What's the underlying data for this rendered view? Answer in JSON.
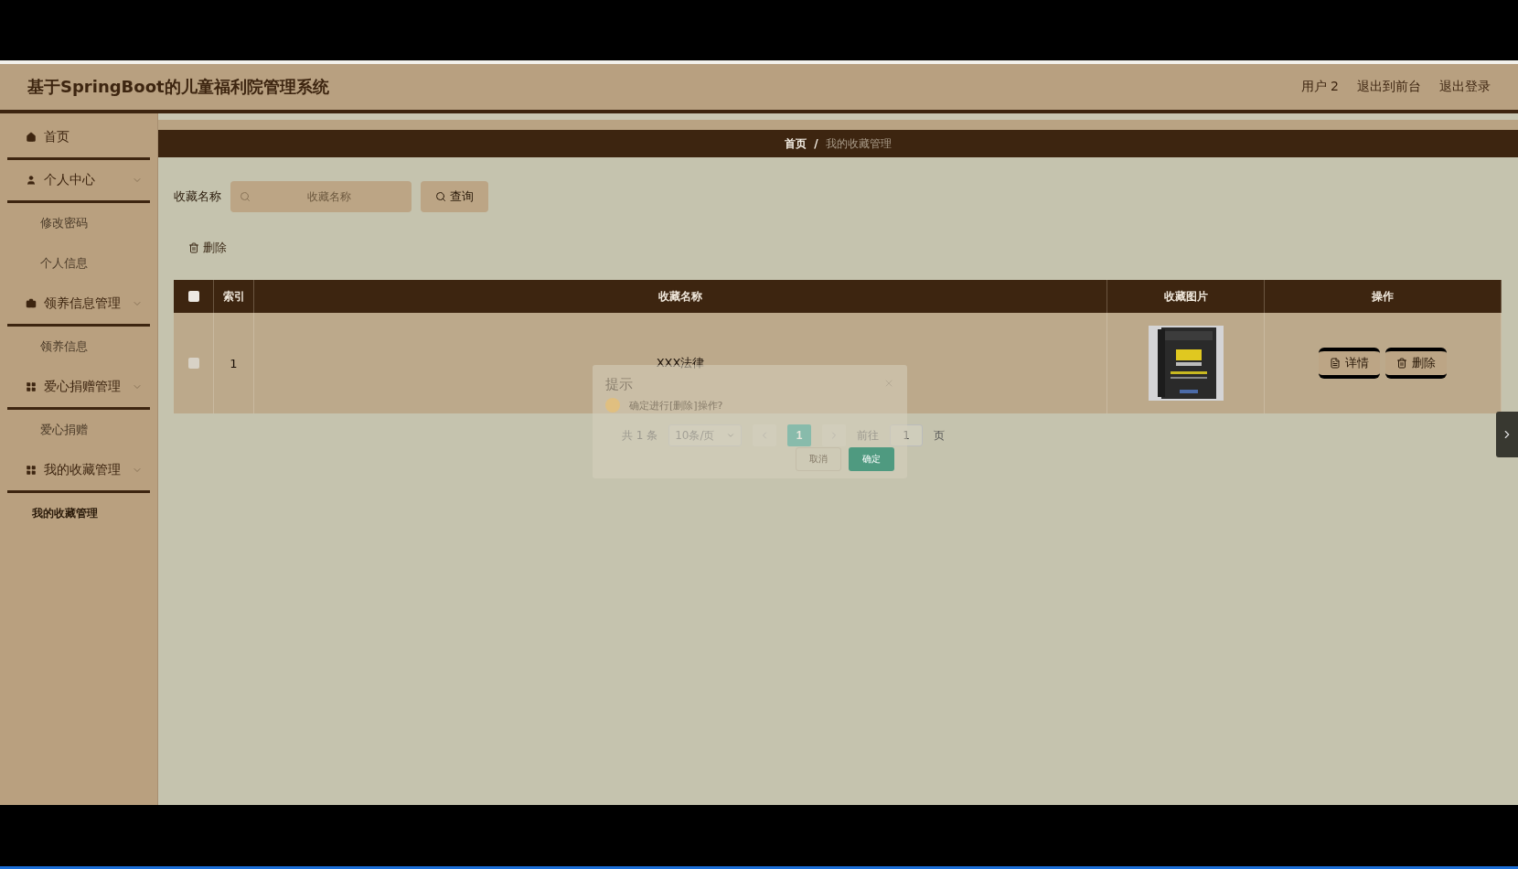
{
  "header": {
    "title": "基于SpringBoot的儿童福利院管理系统",
    "links": [
      "用户 2",
      "退出到前台",
      "退出登录"
    ]
  },
  "sidebar": {
    "items": [
      {
        "label": "首页",
        "kind": "home"
      },
      {
        "label": "个人中心",
        "kind": "user",
        "children": [
          {
            "label": "修改密码",
            "selected": false
          },
          {
            "label": "个人信息",
            "selected": false
          }
        ]
      },
      {
        "label": "领养信息管理",
        "kind": "briefcase",
        "children": [
          {
            "label": "领养信息",
            "selected": false
          }
        ]
      },
      {
        "label": "爱心捐赠管理",
        "kind": "grid",
        "children": [
          {
            "label": "爱心捐赠",
            "selected": false
          }
        ]
      },
      {
        "label": "我的收藏管理",
        "kind": "grid",
        "children": [
          {
            "label": "我的收藏管理",
            "selected": true
          }
        ]
      }
    ]
  },
  "breadcrumb": {
    "items": [
      "首页",
      "我的收藏管理"
    ],
    "separator": "/"
  },
  "search": {
    "label": "收藏名称",
    "placeholder": "收藏名称",
    "button": "查询"
  },
  "delete_button": "删除",
  "table": {
    "header_checked": false,
    "columns": [
      "索引",
      "收藏名称",
      "收藏图片",
      "操作"
    ],
    "rows": [
      {
        "checked": false,
        "index": "1",
        "name": "XXX法律",
        "picture": {
          "kind": "picture"
        },
        "actions": [
          "详情",
          "删除"
        ]
      }
    ]
  },
  "pagination": {
    "total": "共 1 条",
    "page_size": "10条/页",
    "pages": [
      {
        "label": "1",
        "selected": true
      }
    ],
    "goto_label": "前往",
    "goto_value": "1",
    "goto_suffix": "页"
  },
  "dialog": {
    "title": "提示",
    "message": "确定进行[删除]操作?",
    "buttons": [
      "取消",
      "确定"
    ]
  }
}
